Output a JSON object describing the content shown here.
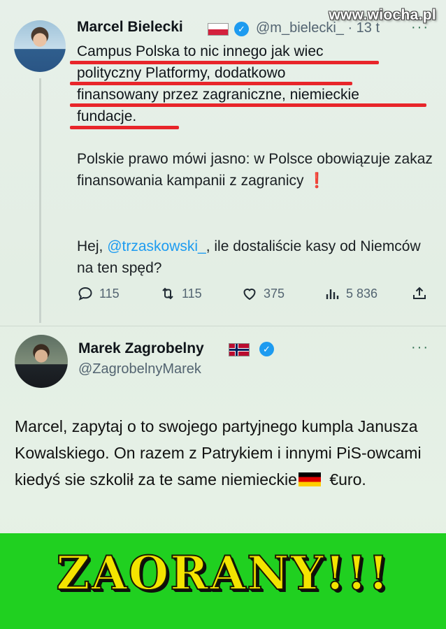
{
  "watermark": "www.wiocha.pl",
  "tweet1": {
    "name": "Marcel Bielecki",
    "handle": "@m_bielecki_ · 13 t",
    "more": "···",
    "lines": [
      "Campus Polska to nic innego jak wiec",
      "polityczny Platformy, dodatkowo",
      "finansowany przez zagraniczne, niemieckie",
      "fundacje."
    ],
    "para2": "Polskie prawo mówi jasno: w Polsce obowiązuje zakaz finansowania kampanii z zagranicy",
    "para2_mark": "❗",
    "para3_prefix": "Hej, ",
    "para3_mention": "@trzaskowski_",
    "para3_suffix": ", ile dostaliście kasy od Niemców na ten spęd?",
    "stats": {
      "replies": "115",
      "reposts": "115",
      "likes": "375",
      "views": "5 836"
    }
  },
  "tweet2": {
    "name": "Marek Zagrobelny",
    "handle": "@ZagrobelnyMarek",
    "more": "···",
    "body_part1": "Marcel, zapytaj o to swojego partyjnego kumpla Janusza Kowalskiego. On razem z Patrykiem i innymi PiS-owcami kiedyś sie szkolił za te same niemieckie",
    "body_part2": " €uro."
  },
  "banner": {
    "text": "ZAORANY!!!",
    "color": "#20d020",
    "text_color": "#f4e400"
  },
  "colors": {
    "accent": "#1d9bf0",
    "underline": "#e8252a"
  }
}
